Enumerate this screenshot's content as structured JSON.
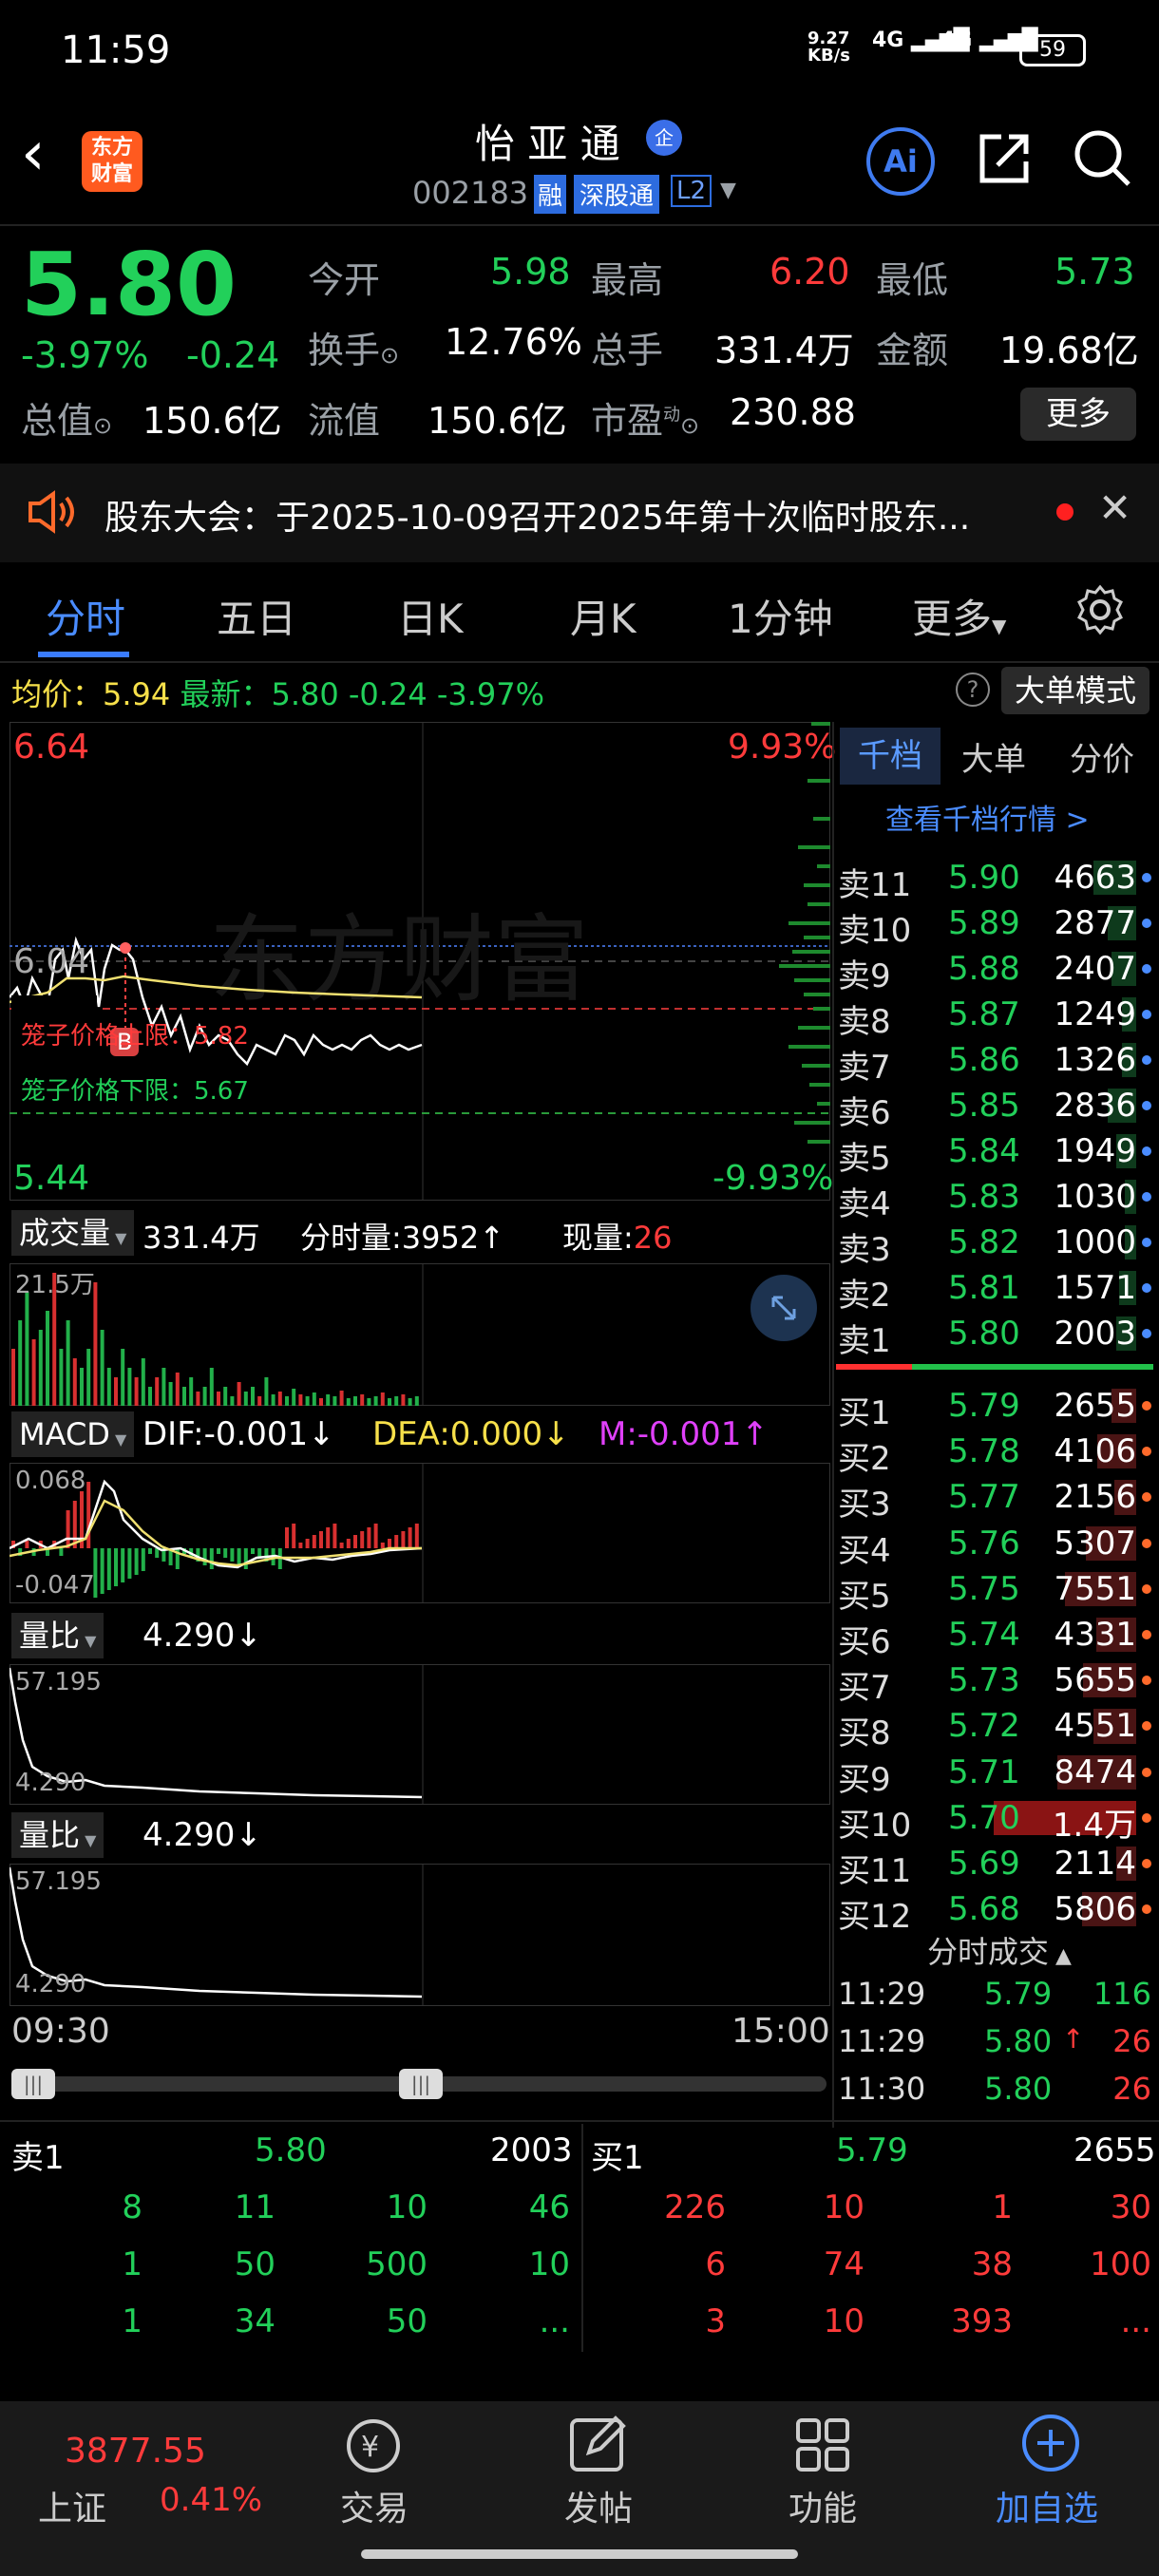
{
  "status": {
    "time": "11:59",
    "net": "9.27",
    "net_unit": "KB/s",
    "sig1": "4G",
    "sig2": "4G",
    "battery": "59"
  },
  "header": {
    "logo": "东方财富",
    "title": "怡 亚 通",
    "badge": "企",
    "code": "002183",
    "tag_rong": "融",
    "tag_sgt": "深股通",
    "tag_l2": "L2"
  },
  "quote": {
    "price": "5.80",
    "pct": "-3.97%",
    "chg": "-0.24",
    "open_label": "今开",
    "open": "5.98",
    "high_label": "最高",
    "high": "6.20",
    "low_label": "最低",
    "low": "5.73",
    "turnover_label": "换手",
    "turnover": "12.76%",
    "vol_label": "总手",
    "vol": "331.4万",
    "amt_label": "金额",
    "amt": "19.68亿",
    "mcap_label": "总值",
    "mcap": "150.6亿",
    "float_label": "流值",
    "float": "150.6亿",
    "pe_label": "市盈",
    "pe_sup": "动",
    "pe": "230.88",
    "more": "更多"
  },
  "notice": {
    "text": "股东大会：于2025-10-09召开2025年第十次临时股东..."
  },
  "tabs": [
    "分时",
    "五日",
    "日K",
    "月K",
    "1分钟",
    "更多"
  ],
  "chart_info": {
    "avg_label": "均价：",
    "avg": "5.94",
    "last_label": "最新：",
    "last": "5.80",
    "chg": "-0.24",
    "pct": "-3.97%",
    "mode": "大单模式"
  },
  "price_axis": {
    "top": "6.64",
    "top_pct": "9.93%",
    "mid": "6.04",
    "bottom": "5.44",
    "bottom_pct": "-9.93%",
    "cage_up": "笼子价格上限：5.82",
    "cage_down": "笼子价格下限：5.67",
    "marker": "B"
  },
  "volume": {
    "label": "成交量",
    "total": "331.4万",
    "min_label": "分时量:",
    "min_val": "3952↑",
    "now_label": "现量:",
    "now_val": "26",
    "axis_top": "21.5万"
  },
  "macd": {
    "label": "MACD",
    "dif": "DIF:-0.001↓",
    "dea": "DEA:0.000↓",
    "m": "M:-0.001↑",
    "axis_top": "0.068",
    "axis_bottom": "-0.047"
  },
  "ratio1": {
    "label": "量比",
    "val": "4.290↓",
    "axis_top": "57.195",
    "axis_bottom": "4.290"
  },
  "ratio2": {
    "label": "量比",
    "val": "4.290↓",
    "axis_top": "57.195",
    "axis_bottom": "4.290"
  },
  "time_axis": {
    "start": "09:30",
    "end": "15:00"
  },
  "right_tabs": [
    "千档",
    "大单",
    "分价"
  ],
  "book_link": "查看千档行情 >",
  "asks": [
    {
      "label": "卖11",
      "price": "5.90",
      "vol": "4663",
      "fill": 0.3,
      "dot": "blue"
    },
    {
      "label": "卖10",
      "price": "5.89",
      "vol": "2877",
      "fill": 0.2,
      "dot": "blue"
    },
    {
      "label": "卖9",
      "price": "5.88",
      "vol": "2407",
      "fill": 0.17,
      "dot": "blue"
    },
    {
      "label": "卖8",
      "price": "5.87",
      "vol": "1249",
      "fill": 0.1,
      "dot": "blue"
    },
    {
      "label": "卖7",
      "price": "5.86",
      "vol": "1326",
      "fill": 0.1,
      "dot": "blue"
    },
    {
      "label": "卖6",
      "price": "5.85",
      "vol": "2836",
      "fill": 0.2,
      "dot": "blue"
    },
    {
      "label": "卖5",
      "price": "5.84",
      "vol": "1949",
      "fill": 0.14,
      "dot": "blue"
    },
    {
      "label": "卖4",
      "price": "5.83",
      "vol": "1030",
      "fill": 0.08,
      "dot": "blue"
    },
    {
      "label": "卖3",
      "price": "5.82",
      "vol": "1000",
      "fill": 0.08,
      "dot": "blue"
    },
    {
      "label": "卖2",
      "price": "5.81",
      "vol": "1571",
      "fill": 0.12,
      "dot": "blue"
    },
    {
      "label": "卖1",
      "price": "5.80",
      "vol": "2003",
      "fill": 0.14,
      "dot": "blue"
    }
  ],
  "bids": [
    {
      "label": "买1",
      "price": "5.79",
      "vol": "2655",
      "fill": 0.17,
      "dot": "orange"
    },
    {
      "label": "买2",
      "price": "5.78",
      "vol": "4106",
      "fill": 0.27,
      "dot": "orange"
    },
    {
      "label": "买3",
      "price": "5.77",
      "vol": "2156",
      "fill": 0.15,
      "dot": "orange"
    },
    {
      "label": "买4",
      "price": "5.76",
      "vol": "5307",
      "fill": 0.35,
      "dot": "orange"
    },
    {
      "label": "买5",
      "price": "5.75",
      "vol": "7551",
      "fill": 0.5,
      "dot": "orange"
    },
    {
      "label": "买6",
      "price": "5.74",
      "vol": "4331",
      "fill": 0.28,
      "dot": "orange"
    },
    {
      "label": "买7",
      "price": "5.73",
      "vol": "5655",
      "fill": 0.37,
      "dot": "orange"
    },
    {
      "label": "买8",
      "price": "5.72",
      "vol": "4551",
      "fill": 0.3,
      "dot": "orange"
    },
    {
      "label": "买9",
      "price": "5.71",
      "vol": "8474",
      "fill": 0.55,
      "dot": "orange"
    },
    {
      "label": "买10",
      "price": "5.70",
      "vol": "1.4万",
      "fill": 1.0,
      "dot": "orange"
    },
    {
      "label": "买11",
      "price": "5.69",
      "vol": "2114",
      "fill": 0.14,
      "dot": "orange"
    },
    {
      "label": "买12",
      "price": "5.68",
      "vol": "5806",
      "fill": 0.38,
      "dot": "orange"
    }
  ],
  "trades_title": "分时成交",
  "trades": [
    {
      "time": "11:29",
      "price": "5.79",
      "vol": "116",
      "arrow": ""
    },
    {
      "time": "11:29",
      "price": "5.80",
      "vol": "26",
      "arrow": "↑"
    },
    {
      "time": "11:30",
      "price": "5.80",
      "vol": "26",
      "arrow": ""
    }
  ],
  "queue": {
    "sell_label": "卖1",
    "sell_price": "5.80",
    "sell_vol": "2003",
    "buy_label": "买1",
    "buy_price": "5.79",
    "buy_vol": "2655",
    "sell_rows": [
      [
        "8",
        "11",
        "10",
        "46"
      ],
      [
        "1",
        "50",
        "500",
        "10"
      ],
      [
        "1",
        "34",
        "50",
        "..."
      ]
    ],
    "buy_rows": [
      [
        "226",
        "10",
        "1",
        "30"
      ],
      [
        "6",
        "74",
        "38",
        "100"
      ],
      [
        "3",
        "10",
        "393",
        "..."
      ]
    ]
  },
  "bottom_nav": {
    "index_val": "3877.55",
    "index_name": "上证",
    "index_pct": "0.41%",
    "trade": "交易",
    "post": "发帖",
    "func": "功能",
    "add": "加自选"
  }
}
